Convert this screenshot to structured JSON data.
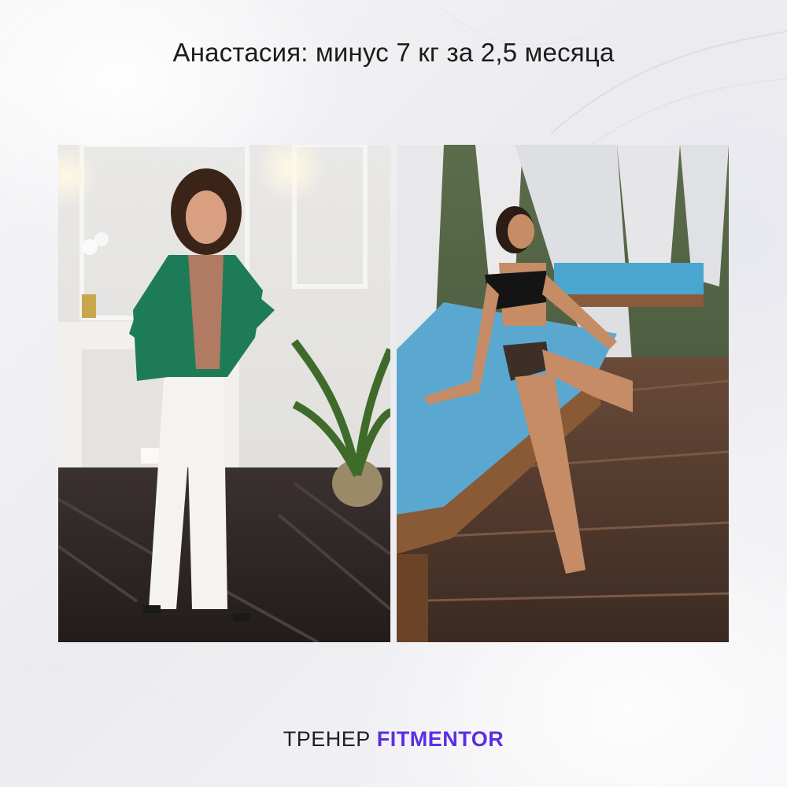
{
  "headline": "Анастасия: минус 7 кг за 2,5 месяца",
  "photos": [
    {
      "icon": "portrait-photo-icon"
    },
    {
      "icon": "swimsuit-photo-icon"
    }
  ],
  "footer": {
    "role": "ТРЕНЕР",
    "brand": "FITMENTOR",
    "brand_color": "#5a2fe0"
  }
}
